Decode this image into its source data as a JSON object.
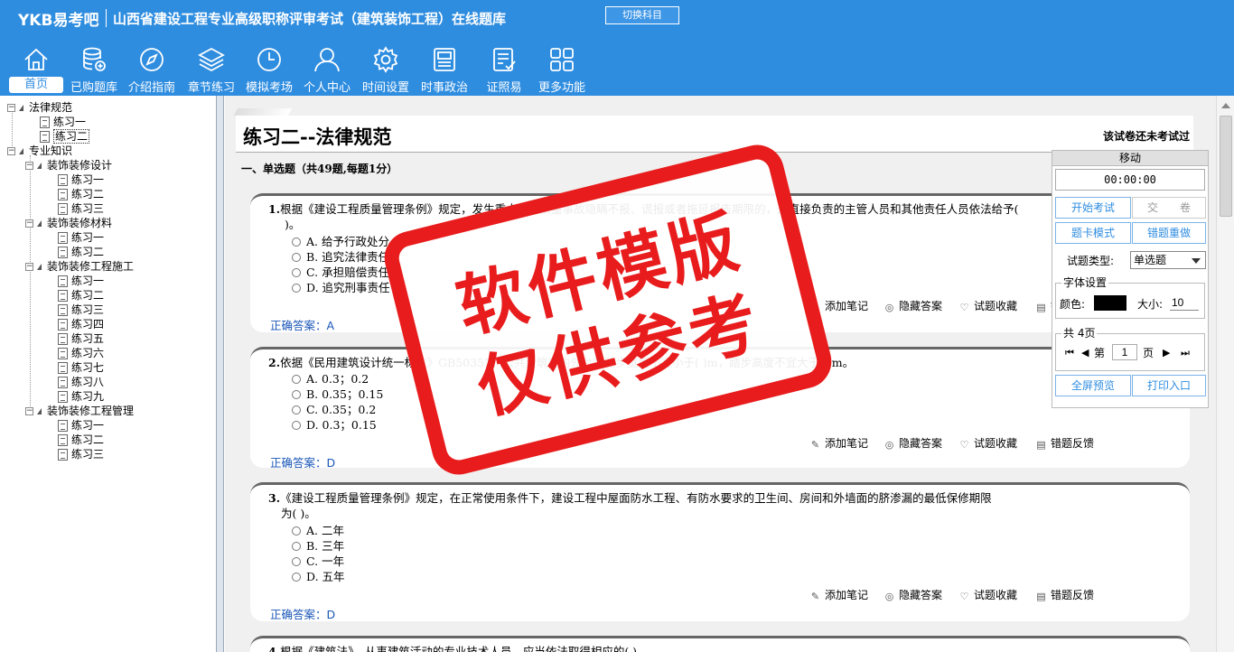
{
  "header": {
    "brand": "YKB易考吧",
    "title": "山西省建设工程专业高级职称评审考试（建筑装饰工程）在线题库",
    "switch_button": "切换科目",
    "nav": [
      {
        "label": "首页",
        "icon": "home-icon"
      },
      {
        "label": "已购题库",
        "icon": "database-icon"
      },
      {
        "label": "介绍指南",
        "icon": "compass-icon"
      },
      {
        "label": "章节练习",
        "icon": "layers-icon"
      },
      {
        "label": "模拟考场",
        "icon": "clock-icon"
      },
      {
        "label": "个人中心",
        "icon": "user-icon"
      },
      {
        "label": "时间设置",
        "icon": "gear-icon"
      },
      {
        "label": "时事政治",
        "icon": "news-icon"
      },
      {
        "label": "证照易",
        "icon": "checklist-icon"
      },
      {
        "label": "更多功能",
        "icon": "grid-icon"
      }
    ]
  },
  "tree": {
    "root1": "法律规范",
    "root1_children": [
      "练习一",
      "练习二"
    ],
    "root2": "专业知识",
    "groups": [
      {
        "label": "装饰装修设计",
        "children": [
          "练习一",
          "练习二",
          "练习三"
        ]
      },
      {
        "label": "装饰装修材料",
        "children": [
          "练习一",
          "练习二"
        ]
      },
      {
        "label": "装饰装修工程施工",
        "children": [
          "练习一",
          "练习二",
          "练习三",
          "练习四",
          "练习五",
          "练习六",
          "练习七",
          "练习八",
          "练习九"
        ]
      },
      {
        "label": "装饰装修工程管理",
        "children": [
          "练习一",
          "练习二",
          "练习三"
        ]
      }
    ]
  },
  "paper": {
    "title": "练习二--法律规范",
    "status": "该试卷还未考试过",
    "section": "一、单选题（共49题,每题1分）"
  },
  "actions": {
    "note": "添加笔记",
    "hide": "隐藏答案",
    "fav": "试题收藏",
    "feedback": "错题反馈"
  },
  "answer_prefix": "正确答案：",
  "questions": [
    {
      "num": "1.",
      "text": "根据《建设工程质量管理条例》规定，发生重大工程质量事故隐瞒不报、谎报或者拖延报告期限的，对直接负责的主管人员和其他责任人员依法给予(",
      "text2": ")。",
      "options": [
        "A. 给予行政处分",
        "B. 追究法律责任",
        "C. 承担赔偿责任",
        "D. 追究刑事责任"
      ],
      "answer": "A"
    },
    {
      "num": "2.",
      "text": "依据《民用建筑设计统一标准》GB50352，公共建筑室内外台阶踏步宽度不宜小于( )m，踏步高度不宜大于( )m。",
      "options": [
        "A. 0.3；0.2",
        "B. 0.35；0.15",
        "C. 0.35；0.2",
        "D. 0.3；0.15"
      ],
      "answer": "D"
    },
    {
      "num": "3.",
      "text": "《建设工程质量管理条例》规定，在正常使用条件下，建设工程中屋面防水工程、有防水要求的卫生间、房间和外墙面的脐渗漏的最低保修期限",
      "text2": "为( )。",
      "options": [
        "A. 二年",
        "B. 三年",
        "C. 一年",
        "D. 五年"
      ],
      "answer": "D"
    },
    {
      "num": "4.",
      "text": "根据《建筑法》，从事建筑活动的专业技术人员，应当依法取得相应的( )。"
    }
  ],
  "panel": {
    "move": "移动",
    "timer": "00:00:00",
    "start": "开始考试",
    "submit": "交　　卷",
    "card_mode": "题卡模式",
    "redo": "错题重做",
    "type_label": "试题类型:",
    "type_value": "单选题",
    "font_legend": "字体设置",
    "color_label": "颜色:",
    "font_color": "#000000",
    "size_label": "大小:",
    "size_value": "10",
    "pages_legend": "共 4页",
    "first": "⏮",
    "prev": "◀",
    "page_prefix": "第",
    "page_value": "1",
    "page_suffix": "页",
    "next": "▶",
    "last": "⏭",
    "preview": "全屏预览",
    "print": "打印入口"
  },
  "watermark": {
    "line1": "软件模版",
    "line2": "仅供参考"
  }
}
